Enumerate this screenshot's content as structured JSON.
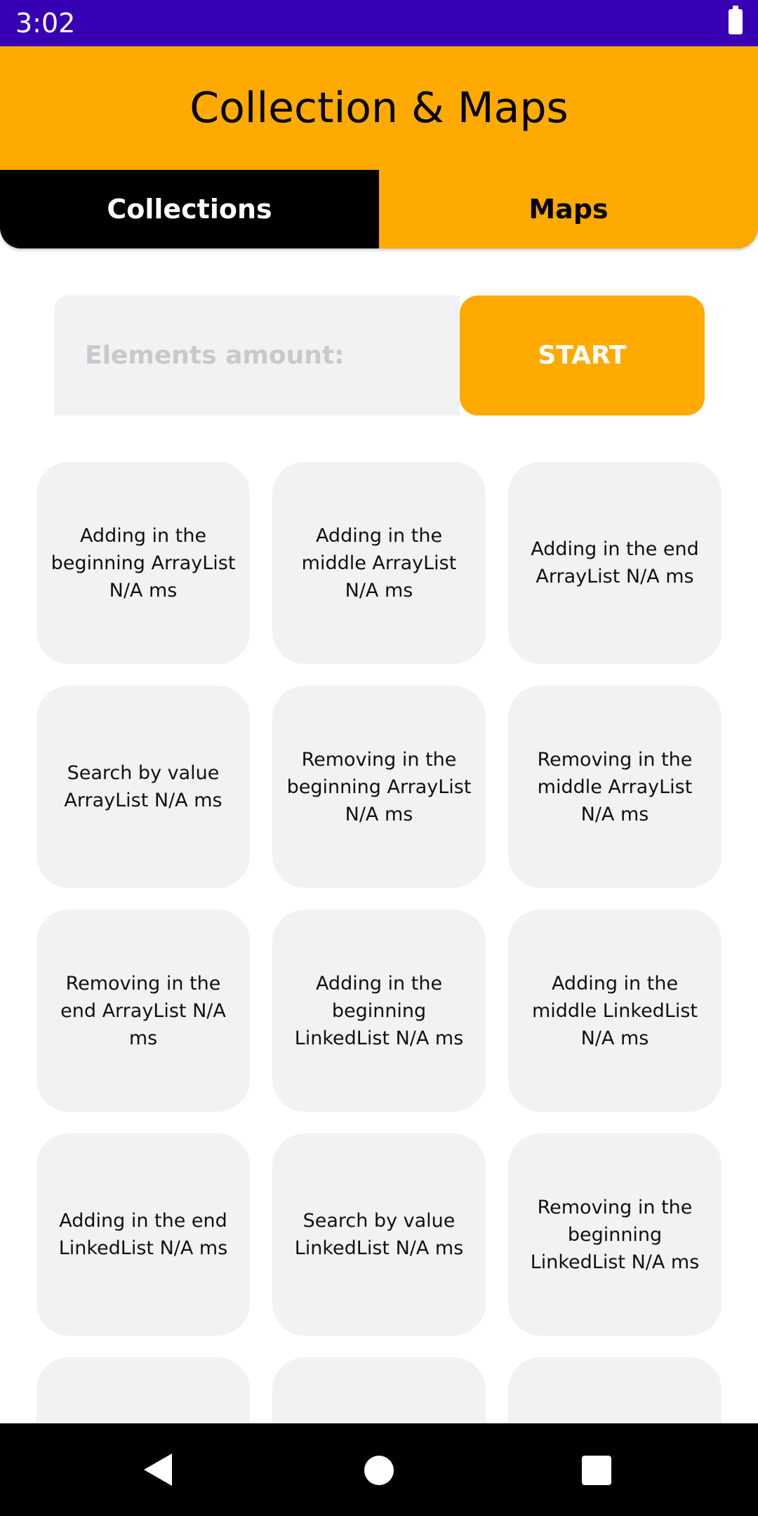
{
  "status_bar": {
    "time": "3:02"
  },
  "app_bar": {
    "title": "Collection & Maps"
  },
  "tabs": [
    {
      "label": "Collections",
      "selected": true
    },
    {
      "label": "Maps",
      "selected": false
    }
  ],
  "controls": {
    "input_placeholder": "Elements amount:",
    "input_value": "",
    "start_label": "START"
  },
  "results": [
    {
      "label": "Adding in the beginning ArrayList N/A ms"
    },
    {
      "label": "Adding in the middle ArrayList N/A ms"
    },
    {
      "label": "Adding in the end ArrayList N/A ms"
    },
    {
      "label": "Search by value ArrayList N/A ms"
    },
    {
      "label": "Removing in the beginning ArrayList N/A ms"
    },
    {
      "label": "Removing in the middle ArrayList N/A ms"
    },
    {
      "label": "Removing in the end ArrayList N/A ms"
    },
    {
      "label": "Adding in the beginning LinkedList N/A ms"
    },
    {
      "label": "Adding in the middle LinkedList N/A ms"
    },
    {
      "label": "Adding in the end LinkedList N/A ms"
    },
    {
      "label": "Search by value LinkedList N/A ms"
    },
    {
      "label": "Removing in the beginning LinkedList N/A ms"
    },
    {
      "label": ""
    },
    {
      "label": ""
    },
    {
      "label": ""
    }
  ],
  "colors": {
    "status_bar": "#3700B3",
    "accent": "#FFAA00",
    "selected_tab": "#000000",
    "card_background": "#F2F2F4"
  },
  "nav_icons": [
    "back-icon",
    "home-icon",
    "recents-icon"
  ]
}
